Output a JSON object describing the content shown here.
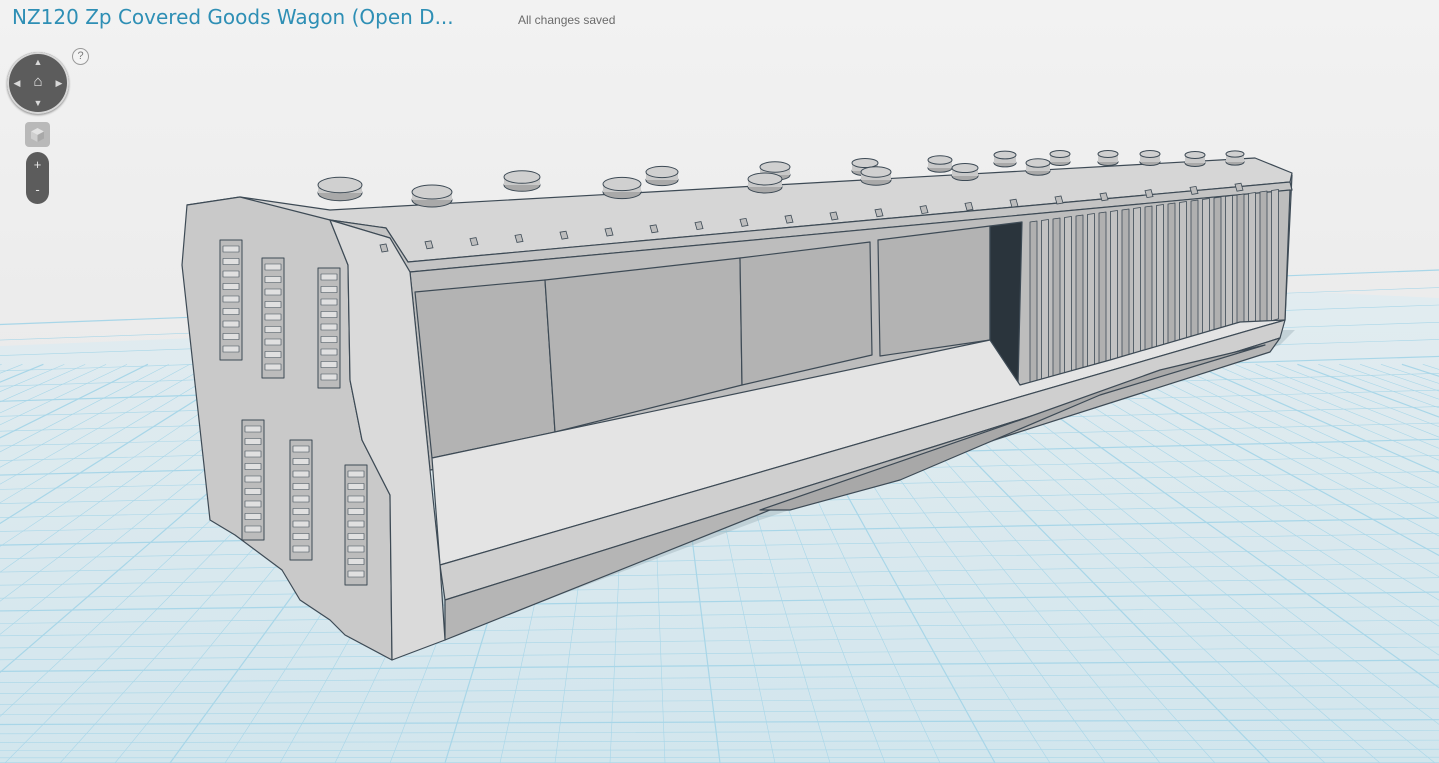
{
  "header": {
    "title": "NZ120 Zp Covered Goods Wagon (Open D...",
    "status": "All changes saved"
  },
  "controls": {
    "help_label": "?",
    "nav_up_icon": "chevron-up-icon",
    "nav_down_icon": "chevron-down-icon",
    "nav_left_icon": "chevron-left-icon",
    "nav_right_icon": "chevron-right-icon",
    "home_icon": "home-icon",
    "view_cube_icon": "cube-icon",
    "zoom_in_label": "+",
    "zoom_out_label": "-"
  },
  "scene": {
    "object": "3D wagon model",
    "colors": {
      "background": "#ededed",
      "grid_line": "#a8d6e8",
      "grid_fill": "#dcebf1",
      "model_light": "#d2d2d2",
      "model_mid": "#b8b8b8",
      "model_dark": "#999999",
      "edge": "#3d4a55",
      "accent": "#2e8fb5"
    }
  }
}
